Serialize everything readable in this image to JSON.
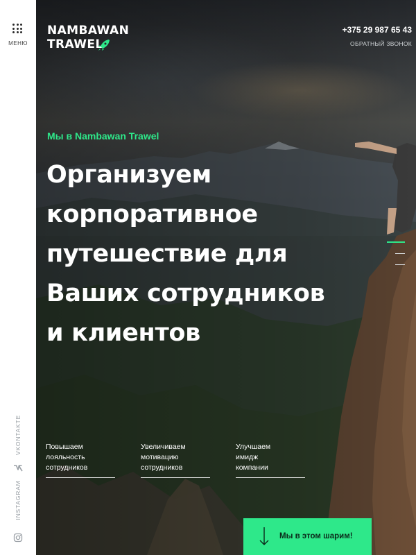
{
  "menu": {
    "label": "МЕНЮ"
  },
  "social": {
    "vk_label": "VKONTAKTE",
    "instagram_label": "INSTAGRAM",
    "vk_icon": "vk-icon",
    "instagram_icon": "instagram-icon"
  },
  "logo": {
    "line1": "NAMBAWAN",
    "line2": "TRAWEL",
    "icon": "rocket-icon"
  },
  "contact": {
    "phone": "+375 29 987 65 43",
    "callback": "ОБРАТНЫЙ ЗВОНОК"
  },
  "hero": {
    "eyebrow": "Мы в Nambawan Trawel",
    "headline": [
      "Организуем",
      "корпоративное",
      "путешествие для",
      "Ваших сотрудников",
      "и клиентов"
    ]
  },
  "slider": {
    "count": 3,
    "active": 1
  },
  "features": [
    {
      "text": [
        "Повышаем",
        "лояльность",
        "сотрудников"
      ]
    },
    {
      "text": [
        "Увеличиваем",
        "мотивацию",
        "сотрудников"
      ]
    },
    {
      "text": [
        "Улучшаем",
        "имидж",
        "компании"
      ]
    }
  ],
  "cta": {
    "label": "Мы в этом шарим!",
    "icon": "arrow-down-icon"
  },
  "colors": {
    "accent": "#2ee88a",
    "rail": "#ffffff",
    "text": "#ffffff"
  }
}
